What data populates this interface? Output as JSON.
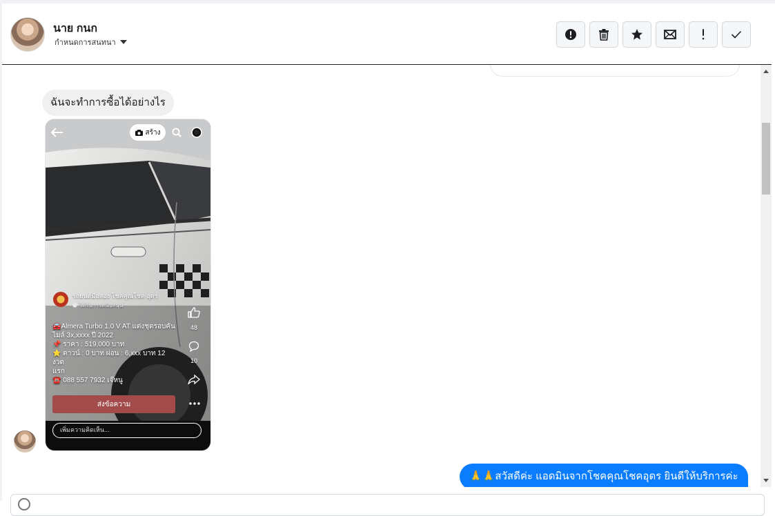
{
  "header": {
    "contact_name": "นาย กนก",
    "assign_label": "กำหนดการสนทนา"
  },
  "actions": [
    {
      "name": "alert-circle-icon",
      "label": "!"
    },
    {
      "name": "trash-icon",
      "label": "delete"
    },
    {
      "name": "star-icon",
      "label": "star"
    },
    {
      "name": "envelope-icon",
      "label": "mail"
    },
    {
      "name": "exclamation-icon",
      "label": "!"
    },
    {
      "name": "check-icon",
      "label": "✓"
    }
  ],
  "messages": {
    "incoming_text": "ฉันจะทำการซื้อได้อย่างไร",
    "outgoing_text": "🙏🙏สวัสดีค่ะ แอดมินจากโชคคุณโชคอุดร ยินดีให้บริการค่ะ"
  },
  "shared_post": {
    "create_label": "สร้าง",
    "page_name": "รถยนต์มือสอง โชคคุณโชค อุดร",
    "sponsored_label": "ได้รับการสนับสนุน",
    "caption_lines": [
      "🚘Almera Turbo 1.0 V AT แต่งชุดรอบคัน",
      "ไมล์ 3x,xxxx ปี 2022",
      "📌 ราคา : 519,000 บาท",
      "⭐ ดาวน์ : 0 บาท ผ่อน : 6,xxx บาท 12 งวด",
      "แรก",
      "☎️ 088 557 7932 เจ๊หนู"
    ],
    "like_count": "48",
    "comment_count": "10",
    "send_button": "ส่งข้อความ",
    "comment_placeholder": "เพิ่มความคิดเห็น..."
  },
  "colors": {
    "outgoing_bubble": "#0a7cff",
    "incoming_bubble": "#f0f0f0",
    "send_button": "#a34a4a"
  }
}
